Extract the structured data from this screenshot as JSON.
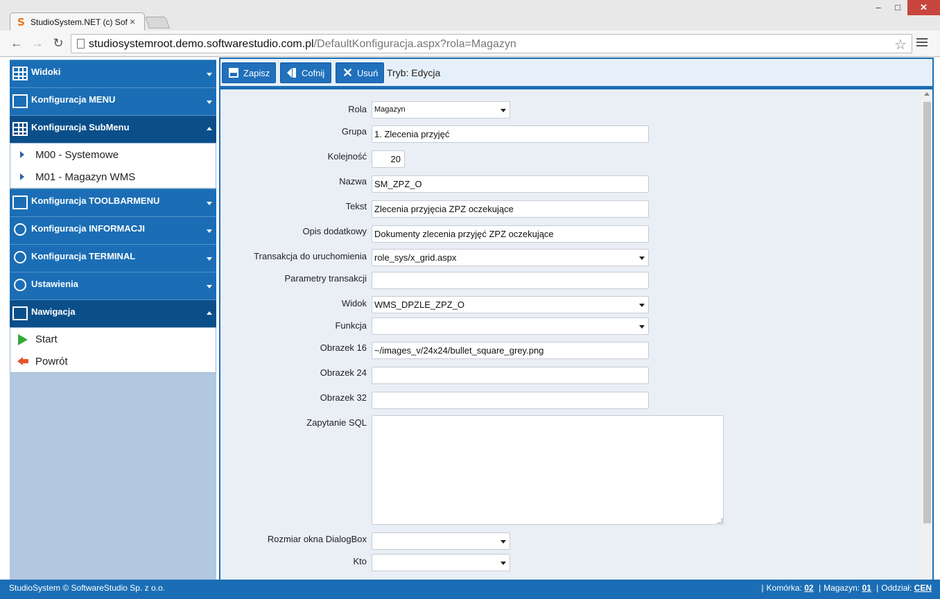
{
  "browser": {
    "tab_title": "StudioSystem.NET (c) Sof",
    "url_host": "studiosystemroot.demo.softwarestudio.com.pl",
    "url_path": "/DefaultKonfiguracja.aspx?rola=Magazyn",
    "win_min": "–",
    "win_max": "□",
    "win_close": "✕",
    "tab_close": "×",
    "favicon": "S"
  },
  "sidebar": {
    "sections": [
      {
        "label": "Widoki",
        "icon": "grid-icon",
        "open": false
      },
      {
        "label": "Konfiguracja MENU",
        "icon": "menu-config-icon",
        "open": false
      },
      {
        "label": "Konfiguracja SubMenu",
        "icon": "submenu-config-icon",
        "open": true,
        "items": [
          "M00 - Systemowe",
          "M01 - Magazyn WMS"
        ]
      },
      {
        "label": "Konfiguracja TOOLBARMENU",
        "icon": "monitor-icon",
        "open": false
      },
      {
        "label": "Konfiguracja INFORMACJI",
        "icon": "info-icon",
        "open": false
      },
      {
        "label": "Konfiguracja TERMINAL",
        "icon": "terminal-icon",
        "open": false
      },
      {
        "label": "Ustawienia",
        "icon": "gear-icon",
        "open": false
      },
      {
        "label": "Nawigacja",
        "icon": "navigation-icon",
        "open": true,
        "items": [
          "Start",
          "Powrót"
        ]
      }
    ]
  },
  "actions": {
    "save": "Zapisz",
    "back": "Cofnij",
    "delete": "Usuń",
    "mode": "Tryb: Edycja"
  },
  "form": {
    "rola": {
      "label": "Rola",
      "value": "Magazyn"
    },
    "grupa": {
      "label": "Grupa",
      "value": "1. Zlecenia przyjęć"
    },
    "kolejnosc": {
      "label": "Kolejność",
      "value": "20"
    },
    "nazwa": {
      "label": "Nazwa",
      "value": "SM_ZPZ_O"
    },
    "tekst": {
      "label": "Tekst",
      "value": "Zlecenia przyjęcia ZPZ oczekujące"
    },
    "opis": {
      "label": "Opis dodatkowy",
      "value": "Dokumenty zlecenia przyjęć ZPZ oczekujące"
    },
    "transakcja": {
      "label": "Transakcja do uruchomienia",
      "value": "role_sys/x_grid.aspx"
    },
    "parametry": {
      "label": "Parametry transakcji",
      "value": ""
    },
    "widok": {
      "label": "Widok",
      "value": "WMS_DPZLE_ZPZ_O"
    },
    "funkcja": {
      "label": "Funkcja",
      "value": ""
    },
    "obrazek16": {
      "label": "Obrazek 16",
      "value": "~/images_v/24x24/bullet_square_grey.png"
    },
    "obrazek24": {
      "label": "Obrazek 24",
      "value": ""
    },
    "obrazek32": {
      "label": "Obrazek 32",
      "value": ""
    },
    "sql": {
      "label": "Zapytanie SQL",
      "value": ""
    },
    "rozmiar": {
      "label": "Rozmiar okna DialogBox",
      "value": ""
    },
    "kto": {
      "label": "Kto",
      "value": ""
    }
  },
  "footer": {
    "copyright": "StudioSystem © SoftwareStudio Sp. z o.o.",
    "komorka_label": "Komórka:",
    "komorka_value": "02",
    "magazyn_label": "Magazyn:",
    "magazyn_value": "01",
    "oddzial_label": "Oddział:",
    "oddzial_value": "CEN"
  }
}
